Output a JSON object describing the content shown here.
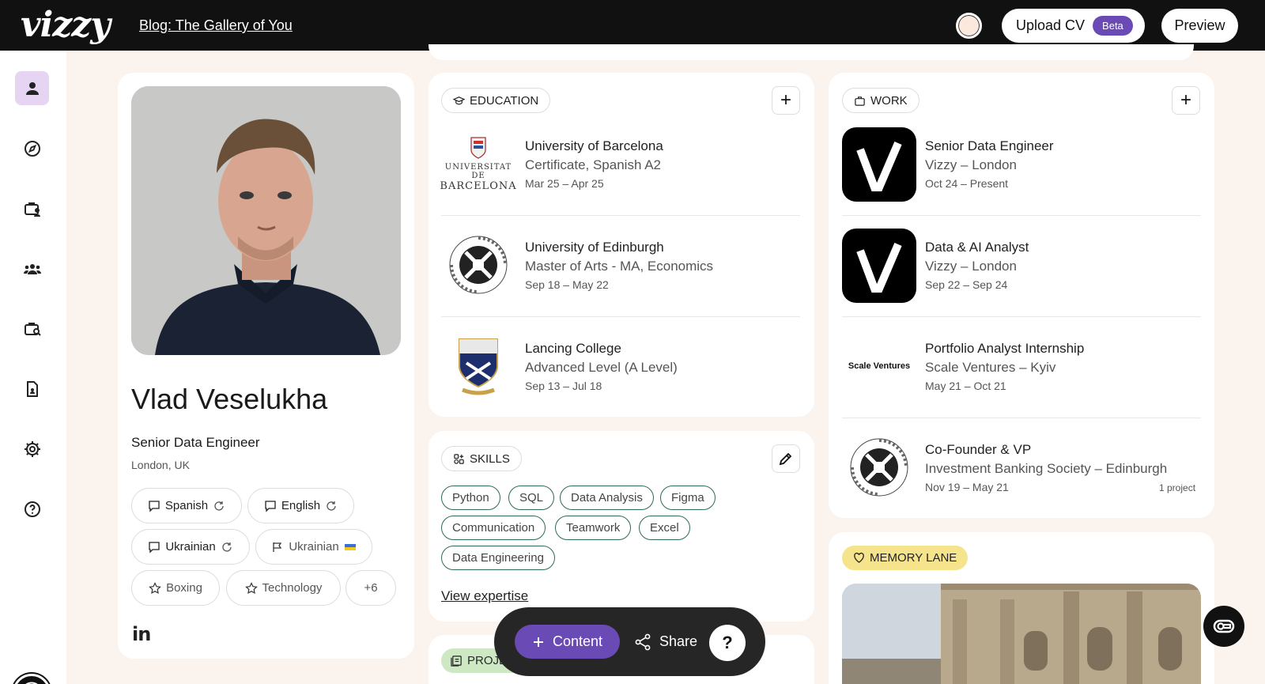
{
  "header": {
    "logo": "vizzy",
    "blog_link": "Blog: The Gallery of You",
    "upload_label": "Upload CV",
    "beta_label": "Beta",
    "preview_label": "Preview"
  },
  "sidebar": {
    "items": [
      {
        "icon": "user-icon",
        "active": true
      },
      {
        "icon": "compass-icon"
      },
      {
        "icon": "briefcase-user-icon"
      },
      {
        "icon": "team-icon"
      },
      {
        "icon": "briefcase-search-icon"
      },
      {
        "icon": "document-icon"
      },
      {
        "icon": "gear-icon"
      },
      {
        "icon": "help-icon"
      }
    ]
  },
  "profile": {
    "name": "Vlad Veselukha",
    "role": "Senior Data Engineer",
    "location": "London, UK",
    "chips": [
      {
        "label": "Spanish",
        "icon": "speech-icon",
        "trailing": "refresh-icon"
      },
      {
        "label": "English",
        "icon": "speech-icon",
        "trailing": "refresh-icon"
      },
      {
        "label": "Ukrainian",
        "icon": "speech-icon",
        "trailing": "refresh-icon"
      },
      {
        "label": "Ukrainian",
        "icon": "flag-icon",
        "trailing": "ukraine-flag"
      },
      {
        "label": "Boxing",
        "icon": "star-icon"
      },
      {
        "label": "Technology",
        "icon": "star-icon"
      },
      {
        "label": "+6"
      }
    ],
    "linkedin": "in"
  },
  "education": {
    "tag": "EDUCATION",
    "entries": [
      {
        "school": "University of Barcelona",
        "degree": "Certificate, Spanish A2",
        "dates": "Mar 25 – Apr 25",
        "logo_text_1": "UNIVERSITAT DE",
        "logo_text_2": "BARCELONA"
      },
      {
        "school": "University of Edinburgh",
        "degree": "Master of Arts - MA, Economics",
        "dates": "Sep 18 – May 22"
      },
      {
        "school": "Lancing College",
        "degree": "Advanced Level (A Level)",
        "dates": "Sep 13 – Jul 18"
      }
    ]
  },
  "skills": {
    "tag": "SKILLS",
    "items": [
      "Python",
      "SQL",
      "Data Analysis",
      "Figma",
      "Communication",
      "Teamwork",
      "Excel",
      "Data Engineering"
    ],
    "view_label": "View expertise"
  },
  "projects": {
    "tag": "PROJECT"
  },
  "work": {
    "tag": "WORK",
    "entries": [
      {
        "title": "Senior Data Engineer",
        "org": "Vizzy – London",
        "dates": "Oct 24 – Present"
      },
      {
        "title": "Data & AI Analyst",
        "org": "Vizzy – London",
        "dates": "Sep 22 – Sep 24"
      },
      {
        "title": "Portfolio Analyst Internship",
        "org": "Scale Ventures – Kyiv",
        "dates": "May 21 – Oct 21",
        "logo_text": "Scale Ventures"
      },
      {
        "title": "Co-Founder & VP",
        "org": "Investment Banking Society – Edinburgh",
        "dates": "Nov 19 – May 21",
        "extra": "1 project"
      }
    ]
  },
  "memory": {
    "tag": "MEMORY LANE"
  },
  "fab": {
    "content_label": "Content",
    "share_label": "Share",
    "help_label": "?"
  },
  "colors": {
    "accent": "#6a4bb5",
    "memory": "#f6e48d",
    "project": "#cfe8c4",
    "skill_border": "#2f6b5a"
  }
}
